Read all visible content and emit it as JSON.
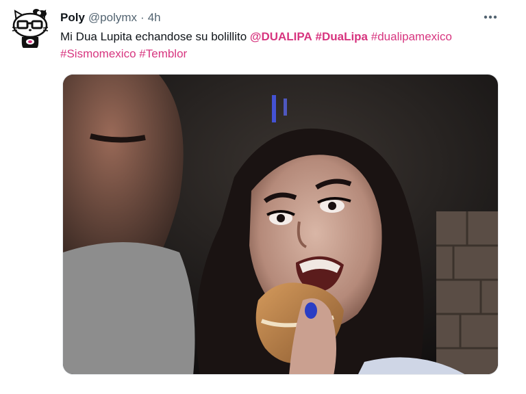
{
  "tweet": {
    "display_name": "Poly",
    "handle": "@polymx",
    "separator": "·",
    "time": "4h",
    "more_label": "More",
    "text_plain": "Mi Dua Lupita echandose su bolillito ",
    "mention": "@DUALIPA",
    "hashtags": [
      "#DuaLipa",
      "#dualipamexico",
      "#Sismomexico",
      "#Temblor"
    ],
    "avatar_icon": "hello-kitty-glasses-avatar",
    "link_color": "#d7357f",
    "media_alt": "Selfie of a woman biting into a bread roll with a man beside her"
  }
}
